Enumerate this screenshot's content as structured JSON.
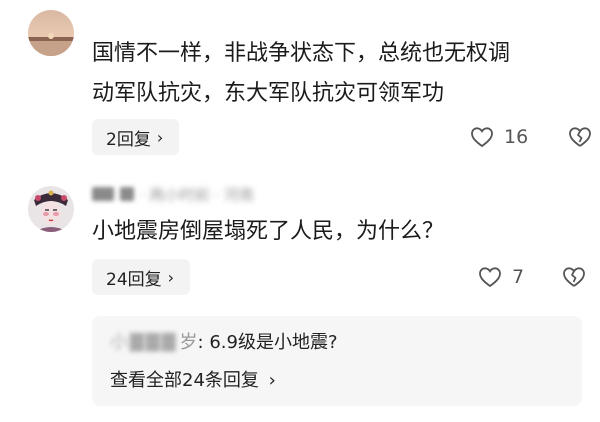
{
  "comments": [
    {
      "text_line1": "国情不一样，非战争状态下，总统也无权调",
      "text_line2": "动军队抗灾，东大军队抗灾可领军功",
      "reply_label": "2回复",
      "like_count": "16",
      "avatar_icon": "sunset-landscape-avatar"
    },
    {
      "meta_obscured": "· 两小时前 · 河南",
      "text": "小地震房倒屋塌死了人民，为什么？",
      "reply_label": "24回复",
      "like_count": "7",
      "avatar_icon": "opera-character-avatar",
      "sub_reply": {
        "name_obscured": "小",
        "name_suffix": "岁",
        "content": ": 6.9级是小地震?",
        "view_all": "查看全部24条回复"
      }
    }
  ],
  "icons": {
    "chevron": "›"
  },
  "colors": {
    "pill_bg": "#f3f3f3",
    "subbox_bg": "#f6f6f6",
    "text": "#1b1b1b"
  }
}
